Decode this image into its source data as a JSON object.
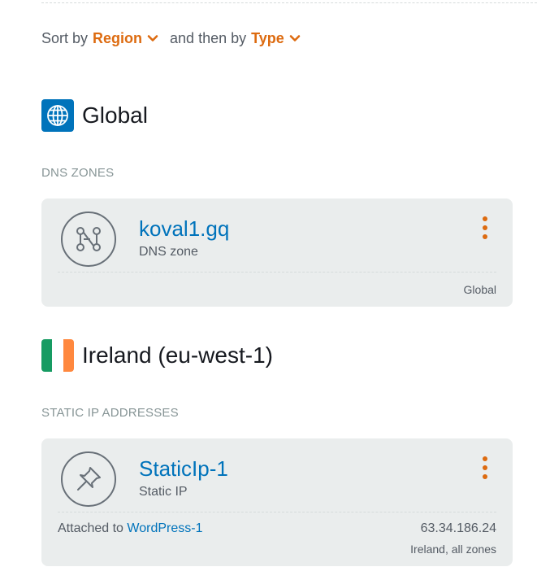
{
  "sort": {
    "prefix": "Sort by",
    "primary": "Region",
    "middle": "and then by",
    "secondary": "Type"
  },
  "regions": [
    {
      "title": "Global",
      "icon": "globe-icon",
      "section": "DNS ZONES",
      "resource": {
        "name": "koval1.gq",
        "type": "DNS zone",
        "location": "Global",
        "icon": "dns-zone-icon"
      }
    },
    {
      "title": "Ireland (eu-west-1)",
      "icon": "ireland-flag-icon",
      "section": "STATIC IP ADDRESSES",
      "resource": {
        "name": "StaticIp-1",
        "type": "Static IP",
        "attached_prefix": "Attached to",
        "attached_to": "WordPress-1",
        "ip": "63.34.186.24",
        "location": "Ireland, all zones",
        "icon": "pushpin-icon"
      }
    }
  ],
  "colors": {
    "accent": "#dd6b10",
    "link": "#0073bb",
    "card_bg": "#eaeded",
    "flag_green": "#169b62",
    "flag_white": "#ffffff",
    "flag_orange": "#ff883e"
  }
}
